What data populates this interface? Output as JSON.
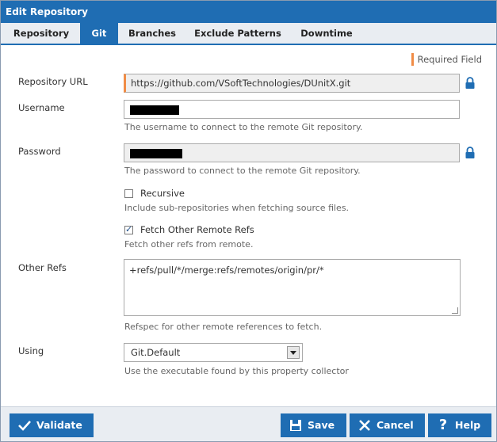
{
  "window": {
    "title": "Edit Repository"
  },
  "tabs": [
    {
      "label": "Repository"
    },
    {
      "label": "Git"
    },
    {
      "label": "Branches"
    },
    {
      "label": "Exclude Patterns"
    },
    {
      "label": "Downtime"
    }
  ],
  "required_field": "Required Field",
  "fields": {
    "repository_url": {
      "label": "Repository URL",
      "value": "https://github.com/VSoftTechnologies/DUnitX.git"
    },
    "username": {
      "label": "Username",
      "hint": "The username to connect to the remote Git repository."
    },
    "password": {
      "label": "Password",
      "hint": "The password to connect to the remote Git repository."
    },
    "recursive": {
      "label": "Recursive",
      "checked": false,
      "hint": "Include sub-repositories when fetching source files."
    },
    "fetch_other_refs": {
      "label": "Fetch Other Remote Refs",
      "checked": true,
      "hint": "Fetch other refs from remote."
    },
    "other_refs": {
      "label": "Other Refs",
      "value": "+refs/pull/*/merge:refs/remotes/origin/pr/*",
      "hint": "Refspec for other remote references to fetch."
    },
    "using": {
      "label": "Using",
      "value": "Git.Default",
      "hint": "Use the executable found by this property collector"
    }
  },
  "buttons": {
    "validate": "Validate",
    "save": "Save",
    "cancel": "Cancel",
    "help": "Help"
  },
  "colors": {
    "accent": "#1f6db3",
    "required": "#f08c46"
  }
}
